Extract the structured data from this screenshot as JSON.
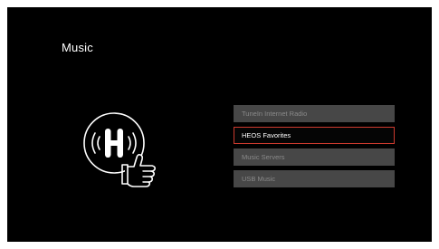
{
  "screen": {
    "title": "Music"
  },
  "logo": {
    "icon": "heos-logo-icon",
    "gesture_icon": "thumbs-up-icon"
  },
  "menu": {
    "selected_index": 1,
    "items": [
      {
        "label": "TuneIn Internet Radio"
      },
      {
        "label": "HEOS Favorites"
      },
      {
        "label": "Music Servers"
      },
      {
        "label": "USB Music"
      }
    ]
  },
  "colors": {
    "background": "#000000",
    "item_background": "#474747",
    "item_text": "#8a8a8a",
    "selected_border": "#cc3a2e",
    "selected_text": "#ffffff"
  }
}
